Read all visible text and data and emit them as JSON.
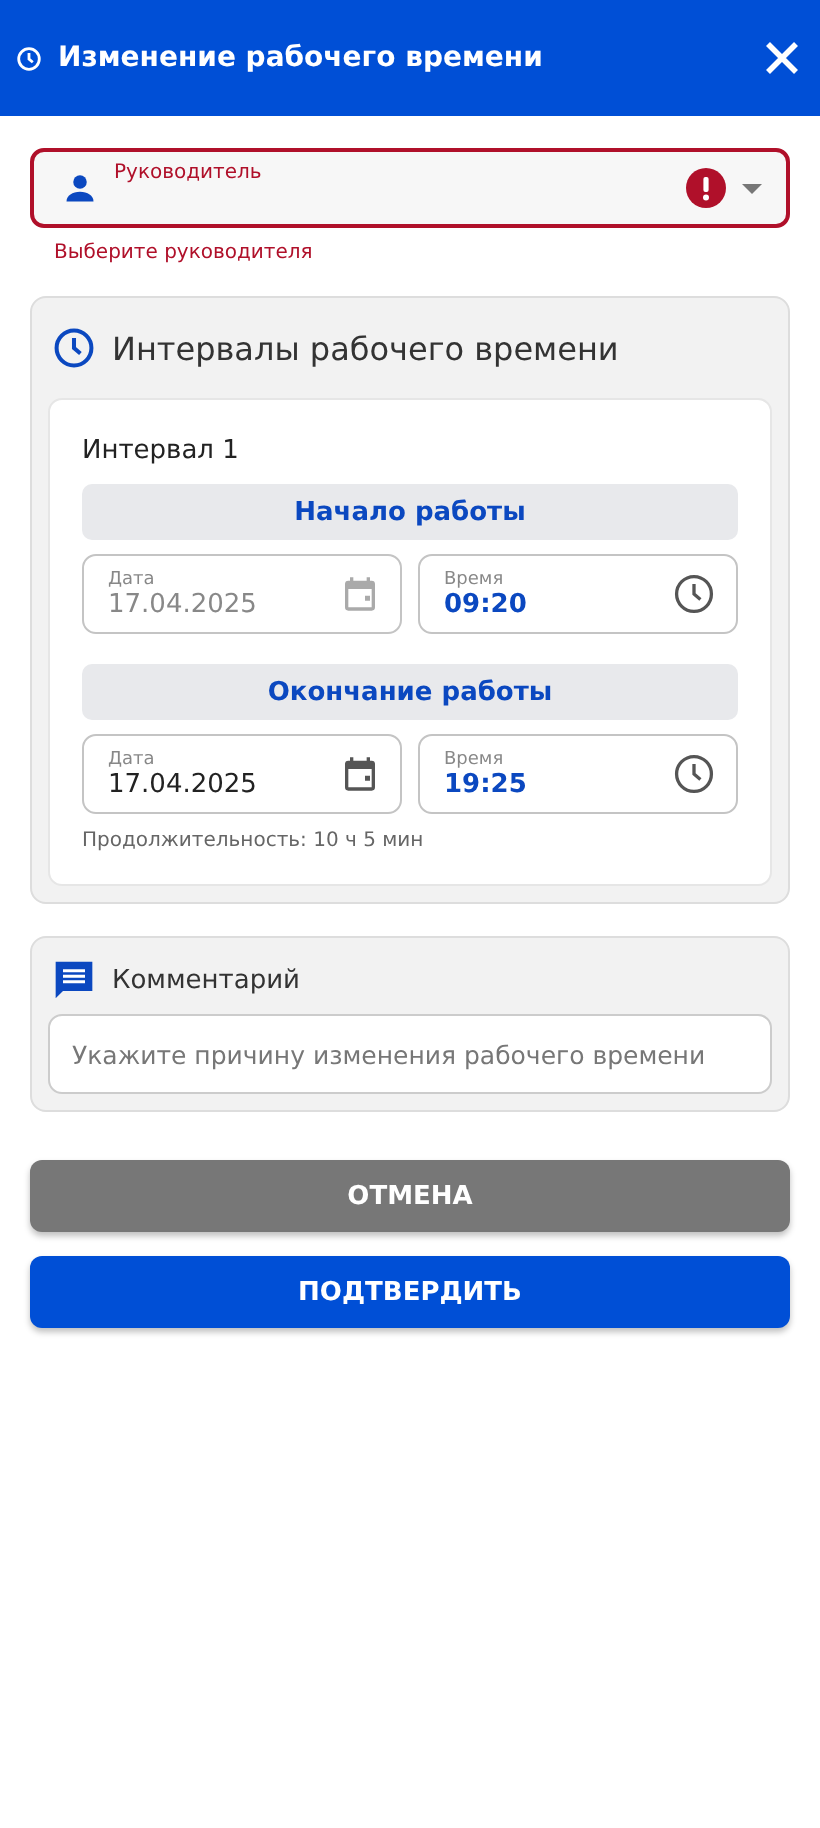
{
  "header": {
    "title": "Изменение рабочего времени"
  },
  "manager": {
    "label": "Руководитель",
    "error": true,
    "error_text": "Выберите руководителя"
  },
  "intervals": {
    "title": "Интервалы рабочего времени",
    "items": [
      {
        "title": "Интервал 1",
        "start": {
          "heading": "Начало работы",
          "date_label": "Дата",
          "date": "17.04.2025",
          "date_disabled": true,
          "time_label": "Время",
          "time": "09:20"
        },
        "end": {
          "heading": "Окончание работы",
          "date_label": "Дата",
          "date": "17.04.2025",
          "date_disabled": false,
          "time_label": "Время",
          "time": "19:25"
        },
        "duration": "Продолжительность: 10 ч 5 мин"
      }
    ]
  },
  "comment": {
    "title": "Комментарий",
    "placeholder": "Укажите причину изменения рабочего времени"
  },
  "buttons": [
    {
      "label": "ОТМЕНА",
      "kind": "secondary"
    },
    {
      "label": "ПОДТВЕРДИТЬ",
      "kind": "primary"
    }
  ]
}
